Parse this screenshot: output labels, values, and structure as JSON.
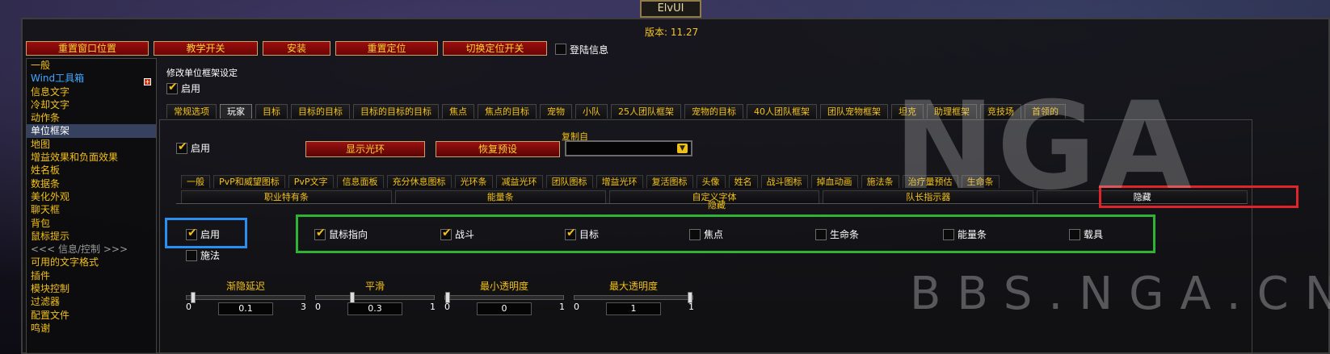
{
  "app": {
    "title": "ElvUI",
    "version_label": "版本:",
    "version_value": "11.27"
  },
  "top_buttons": [
    "重置窗口位置",
    "教学开关",
    "安装",
    "重置定位",
    "切换定位开关"
  ],
  "top_checkbox": {
    "label": "登陆信息",
    "checked": false
  },
  "sidebar": {
    "items": [
      {
        "label": "一般"
      },
      {
        "label": "Wind工具箱",
        "style": "blue"
      },
      {
        "label": "信息文字"
      },
      {
        "label": "冷却文字"
      },
      {
        "label": "动作条"
      },
      {
        "label": "单位框架",
        "active": true
      },
      {
        "label": "地图"
      },
      {
        "label": "增益效果和负面效果"
      },
      {
        "label": "姓名板"
      },
      {
        "label": "数据条"
      },
      {
        "label": "美化外观"
      },
      {
        "label": "聊天框"
      },
      {
        "label": "背包"
      },
      {
        "label": "鼠标提示"
      },
      {
        "label": "<<< 信息/控制 >>>",
        "style": "muted"
      },
      {
        "label": "可用的文字格式"
      },
      {
        "label": "插件"
      },
      {
        "label": "模块控制"
      },
      {
        "label": "过滤器"
      },
      {
        "label": "配置文件"
      },
      {
        "label": "鸣谢"
      }
    ]
  },
  "panel": {
    "title": "修改单位框架设定",
    "enable_label": "启用",
    "unit_tabs": [
      "常规选项",
      "玩家",
      "目标",
      "目标的目标",
      "目标的目标的目标",
      "焦点",
      "焦点的目标",
      "宠物",
      "小队",
      "25人团队框架",
      "宠物的目标",
      "40人团队框架",
      "团队宠物框架",
      "坦克",
      "助理框架",
      "竞技场",
      "首领的"
    ],
    "active_unit_tab": "玩家",
    "player_enable_label": "启用",
    "show_aura_button": "显示光环",
    "restore_defaults_button": "恢复预设",
    "copy_from_label": "复制自",
    "copy_from_value": "",
    "sub_tabs_row1": [
      "一般",
      "PvP和威望图标",
      "PvP文字",
      "信息面板",
      "充分休息图标",
      "光环条",
      "减益光环",
      "团队图标",
      "增益光环",
      "复活图标",
      "头像",
      "姓名",
      "战斗图标",
      "掉血动画",
      "施法条",
      "治疗量预估",
      "生命条"
    ],
    "sub_tabs_row2": [
      "职业特有条",
      "能量条",
      "自定义字体",
      "队长指示器",
      "隐藏"
    ],
    "active_sub_tab": "隐藏",
    "hide_group_title": "隐藏",
    "hide_enable": {
      "label": "启用",
      "checked": true
    },
    "hide_cast": {
      "label": "施法",
      "checked": false
    },
    "hide_options": [
      {
        "label": "鼠标指向",
        "checked": true
      },
      {
        "label": "战斗",
        "checked": true
      },
      {
        "label": "目标",
        "checked": true
      },
      {
        "label": "焦点",
        "checked": false
      },
      {
        "label": "生命条",
        "checked": false
      },
      {
        "label": "能量条",
        "checked": false
      },
      {
        "label": "载具",
        "checked": false
      }
    ],
    "sliders": [
      {
        "label": "渐隐延迟",
        "min": "0",
        "max": "3",
        "value": "0.1",
        "fraction": 0.033
      },
      {
        "label": "平滑",
        "min": "0",
        "max": "1",
        "value": "0.3",
        "fraction": 0.3
      },
      {
        "label": "最小透明度",
        "min": "0",
        "max": "1",
        "value": "0",
        "fraction": 0
      },
      {
        "label": "最大透明度",
        "min": "0",
        "max": "1",
        "value": "1",
        "fraction": 1
      }
    ]
  },
  "watermark": {
    "logo": "NGA",
    "site": "BBS.NGA.CN"
  }
}
